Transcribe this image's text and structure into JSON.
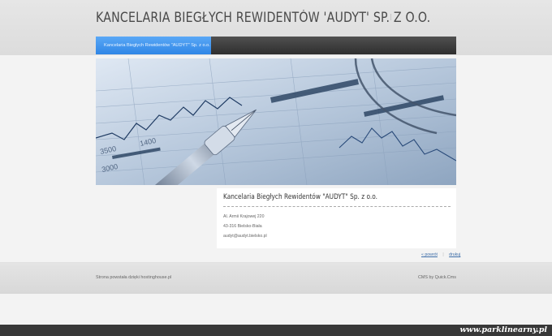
{
  "header": {
    "site_title": "KANCELARIA BIEGŁYCH REWIDENTÓW 'AUDYT' SP. Z O.O."
  },
  "nav": {
    "items": [
      {
        "label": "Kancelaria Biegłych Rewidentów \"AUDYT\" Sp. z o.o.",
        "active": true
      }
    ],
    "accent_color": "#3d92ee"
  },
  "content": {
    "title": "Kancelaria Biegłych Rewidentów \"AUDYT\" Sp. z o.o.",
    "lines": [
      "Al. Armii Krajowej 220",
      "43-316 Bielsko-Biała",
      "audyt@audyt.bielsko.pl"
    ],
    "links": {
      "back": "« powrót",
      "print": "drukuj"
    }
  },
  "footer": {
    "left": "Strona powstała dzięki hostinghouse.pl",
    "right": "CMS by Quick.Cms"
  },
  "parking": {
    "label": "www.parklinearny.pl"
  }
}
